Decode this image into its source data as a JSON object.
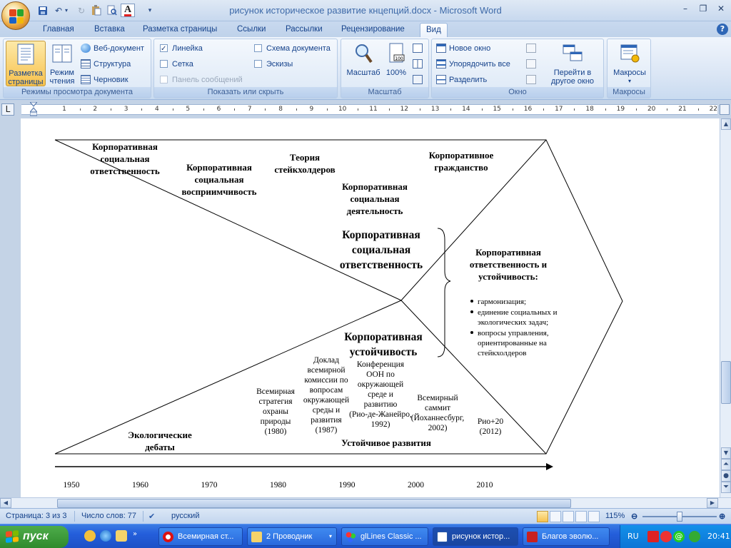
{
  "window": {
    "title": "рисунок историческое развитие кнцепций.docx - Microsoft Word",
    "controls": [
      "–",
      "❐",
      "✕"
    ]
  },
  "tabs": [
    {
      "label": "Главная"
    },
    {
      "label": "Вставка"
    },
    {
      "label": "Разметка страницы"
    },
    {
      "label": "Ссылки"
    },
    {
      "label": "Рассылки"
    },
    {
      "label": "Рецензирование"
    },
    {
      "label": "Вид",
      "active": true
    }
  ],
  "ribbon": {
    "views": {
      "group_label": "Режимы просмотра документа",
      "print_layout": "Разметка страницы",
      "reading": "Режим чтения",
      "web": "Веб-документ",
      "outline": "Структура",
      "draft": "Черновик"
    },
    "show": {
      "group_label": "Показать или скрыть",
      "ruler": "Линейка",
      "ruler_checked": true,
      "grid": "Сетка",
      "grid_checked": false,
      "message_bar": "Панель сообщений",
      "doc_map": "Схема документа",
      "doc_map_checked": false,
      "thumbnails": "Эскизы",
      "thumbnails_checked": false
    },
    "zoom": {
      "group_label": "Масштаб",
      "zoom": "Масштаб",
      "hundred": "100%"
    },
    "window": {
      "group_label": "Окно",
      "new_window": "Новое окно",
      "arrange_all": "Упорядочить все",
      "split": "Разделить",
      "switch": "Перейти в другое окно"
    },
    "macros": {
      "group_label": "Макросы",
      "macros": "Макросы"
    }
  },
  "ruler": {
    "numbers": [
      "1",
      "2",
      "3",
      "4",
      "5",
      "6",
      "7",
      "8",
      "9",
      "10",
      "11",
      "12",
      "13",
      "14",
      "15",
      "16",
      "17",
      "18",
      "19",
      "20",
      "21",
      "22"
    ]
  },
  "diagram": {
    "csr_title": "Корпоративная социальная ответственность",
    "responsiveness": "Корпоративная социальная восприимчивость",
    "stakeholders": "Теория стейкхолдеров",
    "citizenship": "Корпоративное гражданство",
    "activity": "Корпоративная социальная деятельность",
    "center_csr": "Корпоративная социальная ответственность",
    "center_sust": "Корпоративная устойчивость",
    "right_title": "Корпоративная ответственность и устойчивость:",
    "bullets": [
      "гармонизация;",
      "единение социальных и экологических задач;",
      "вопросы управления, ориентированные на стейкхолдеров"
    ],
    "eco": "Экологические дебаты",
    "sustdev": "Устойчивое развития",
    "ev1980": "Всемирная стратегия охраны природы (1980)",
    "ev1987": "Доклад всемирной комиссии по вопросам окружающей среды и развития (1987)",
    "ev1992": "Конференция ООН по окружающей среде и развитию (Рио-де-Жанейро, 1992)",
    "ev2002": "Всемирный саммит (Йоханнесбург, 2002)",
    "ev2012": "Рио+20 (2012)",
    "years": [
      "1950",
      "1960",
      "1970",
      "1980",
      "1990",
      "2000",
      "2010"
    ]
  },
  "status": {
    "page": "Страница: 3 из 3",
    "words": "Число слов: 77",
    "lang": "русский",
    "zoom": "115%",
    "zoom_fraction": 0.55
  },
  "taskbar": {
    "start": "пуск",
    "buttons": [
      {
        "label": "Всемирная ст..."
      },
      {
        "label": "2 Проводник"
      },
      {
        "label": "glLines Classic ..."
      },
      {
        "label": "рисунок истор..."
      },
      {
        "label": "Благов эволю..."
      }
    ],
    "lang": "RU",
    "time": "20:41"
  },
  "colors": {
    "ribbon_blue": "#15428b",
    "active_orange": "#f7c24d",
    "taskbar_blue": "#245edb",
    "start_green": "#2f8a2c"
  }
}
